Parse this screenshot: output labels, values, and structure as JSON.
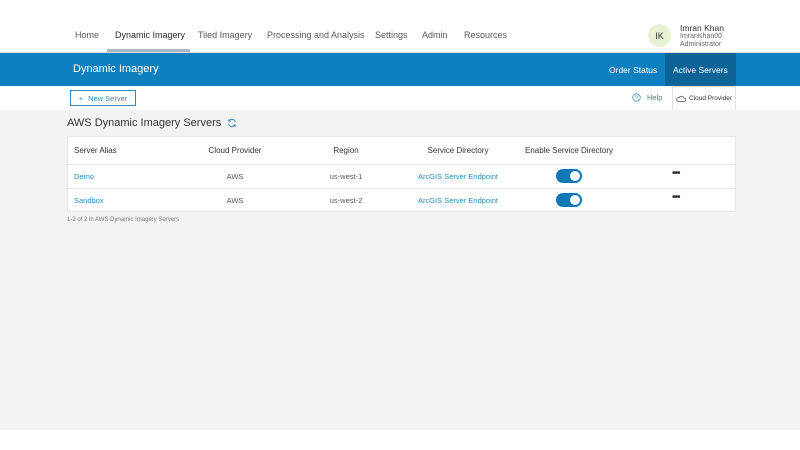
{
  "nav": {
    "items": [
      "Home",
      "Dynamic Imagery",
      "Tiled Imagery",
      "Processing and Analysis",
      "Settings",
      "Admin",
      "Resources"
    ],
    "active": "Dynamic Imagery"
  },
  "user": {
    "initials": "IK",
    "name": "Imran Khan",
    "username": "ImranKhan00",
    "role": "Administrator"
  },
  "subheader": {
    "title": "Dynamic Imagery",
    "links": [
      "Order Status",
      "Active Servers"
    ],
    "active": "Active Servers"
  },
  "toolbar": {
    "new_server": "New Server",
    "help": "Help",
    "cloud_provider": "Cloud Provider"
  },
  "section": {
    "title": "AWS Dynamic Imagery Servers"
  },
  "table": {
    "headers": [
      "Server Alias",
      "Cloud Provider",
      "Region",
      "Service Directory",
      "Enable Service Directory"
    ],
    "rows": [
      {
        "alias": "Demo",
        "provider": "AWS",
        "region": "us-west-1",
        "directory": "ArcGIS Server Endpoint",
        "enabled": true
      },
      {
        "alias": "Sandbox",
        "provider": "AWS",
        "region": "us-west-2",
        "directory": "ArcGIS Server Endpoint",
        "enabled": true
      }
    ]
  },
  "footer": "1-2 of 2 in AWS Dynamic Imagery Servers",
  "colors": {
    "brand": "#0f80bf",
    "active_tab": "#0c6596",
    "link": "#2e8bc0"
  }
}
